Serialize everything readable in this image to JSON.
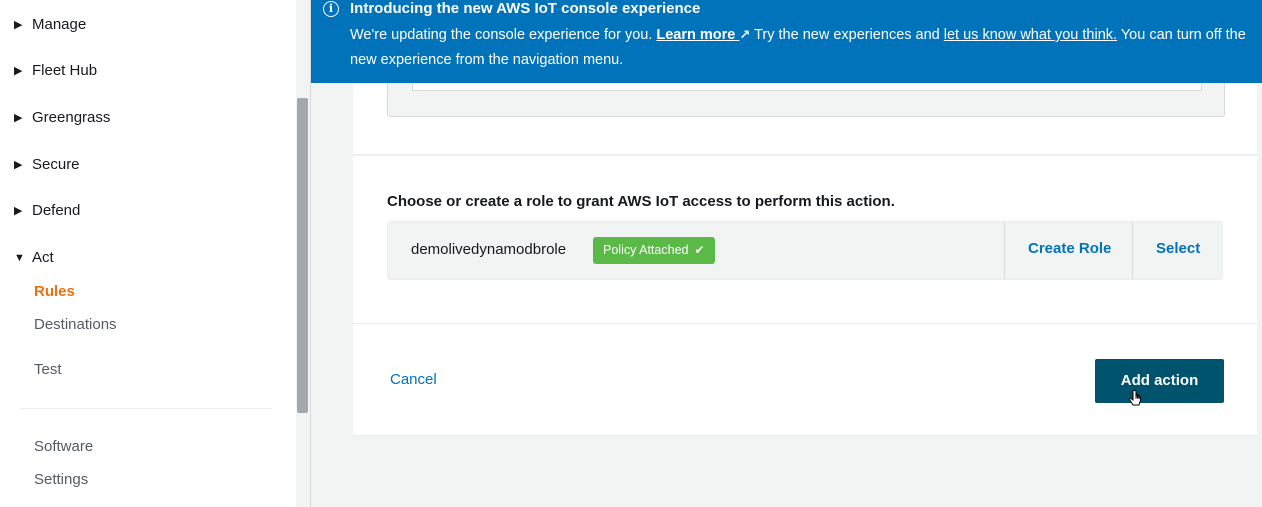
{
  "sidebar": {
    "groups": [
      {
        "label": "Manage",
        "expanded": false
      },
      {
        "label": "Fleet Hub",
        "expanded": false
      },
      {
        "label": "Greengrass",
        "expanded": false
      },
      {
        "label": "Secure",
        "expanded": false
      },
      {
        "label": "Defend",
        "expanded": false
      },
      {
        "label": "Act",
        "expanded": true
      }
    ],
    "act_items": [
      {
        "label": "Rules",
        "active": true
      },
      {
        "label": "Destinations",
        "active": false
      },
      {
        "label": "Test",
        "active": false
      }
    ],
    "bottom_items": [
      {
        "label": "Software"
      },
      {
        "label": "Settings"
      }
    ],
    "caret_collapsed": "▶",
    "caret_expanded": "▼"
  },
  "banner": {
    "icon": "info-icon",
    "icon_glyph": "i",
    "title": "Introducing the new AWS IoT console experience",
    "text_1": "We're updating the console experience for you. ",
    "learn_more": "Learn more",
    "external_glyph": "↗",
    "text_2": " Try the new experiences and ",
    "feedback_link": "let us know what you think.",
    "text_3": " You can turn off the new experience from the navigation menu."
  },
  "role": {
    "heading": "Choose or create a role to grant AWS IoT access to perform this action.",
    "role_name": "demolivedynamodbrole",
    "badge_label": "Policy Attached",
    "badge_icon_glyph": "✔",
    "create_role_label": "Create Role",
    "select_label": "Select"
  },
  "actions": {
    "cancel_label": "Cancel",
    "add_action_label": "Add action"
  },
  "colors": {
    "banner": "#0073bb",
    "primary_button": "#00536d",
    "link": "#0073bb",
    "active_nav": "#ec7211",
    "badge": "#5bb947"
  }
}
